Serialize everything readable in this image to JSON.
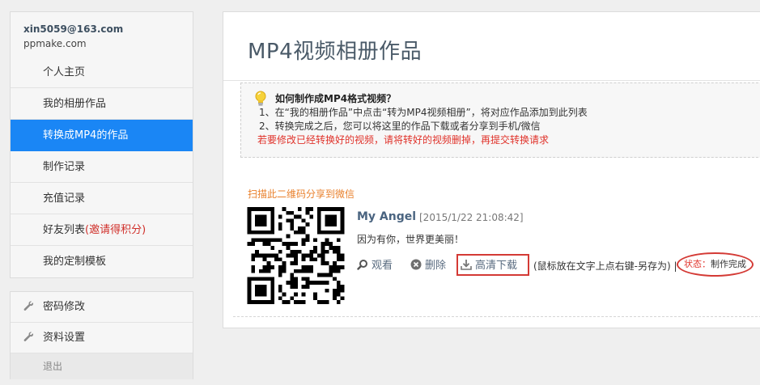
{
  "account": {
    "email": "xin5059@163.com",
    "site": "ppmake.com"
  },
  "nav": {
    "items": [
      {
        "label": "个人主页"
      },
      {
        "label": "我的相册作品"
      },
      {
        "label": "转换成MP4的作品"
      },
      {
        "label": "制作记录"
      },
      {
        "label": "充值记录"
      },
      {
        "label": "好友列表",
        "extra": "(邀请得积分)"
      },
      {
        "label": "我的定制模板"
      }
    ]
  },
  "settings": {
    "items": [
      {
        "label": "密码修改",
        "icon": "wrench-icon"
      },
      {
        "label": "资料设置",
        "icon": "wrench-icon"
      }
    ],
    "logout": "退出"
  },
  "main": {
    "title": "MP4视频相册作品",
    "tips": {
      "question": "如何制作成MP4格式视频？",
      "line1": "1、在“我的相册作品”中点击“转为MP4视频相册”，将对应作品添加到此列表",
      "line2": "2、转换完成之后，您可以将这里的作品下载或者分享到手机/微信",
      "warning": "若要修改已经转换好的视频，请将转好的视频删掉，再提交转换请求"
    },
    "share_hint": "扫描此二维码分享到微信",
    "video": {
      "title": "My Angel",
      "date": "[2015/1/22 21:08:42]",
      "description": "因为有你，世界更美丽！",
      "actions": {
        "view": "观看",
        "delete": "删除",
        "download": "高清下载"
      },
      "note": "(鼠标放在文字上点右键-另存为) |",
      "status_label": "状态：",
      "status_value": "制作完成"
    }
  },
  "colors": {
    "accent": "#1a86f5",
    "warning": "#e0322a",
    "hint": "#e9802c",
    "highlight_box": "#d43a35"
  }
}
